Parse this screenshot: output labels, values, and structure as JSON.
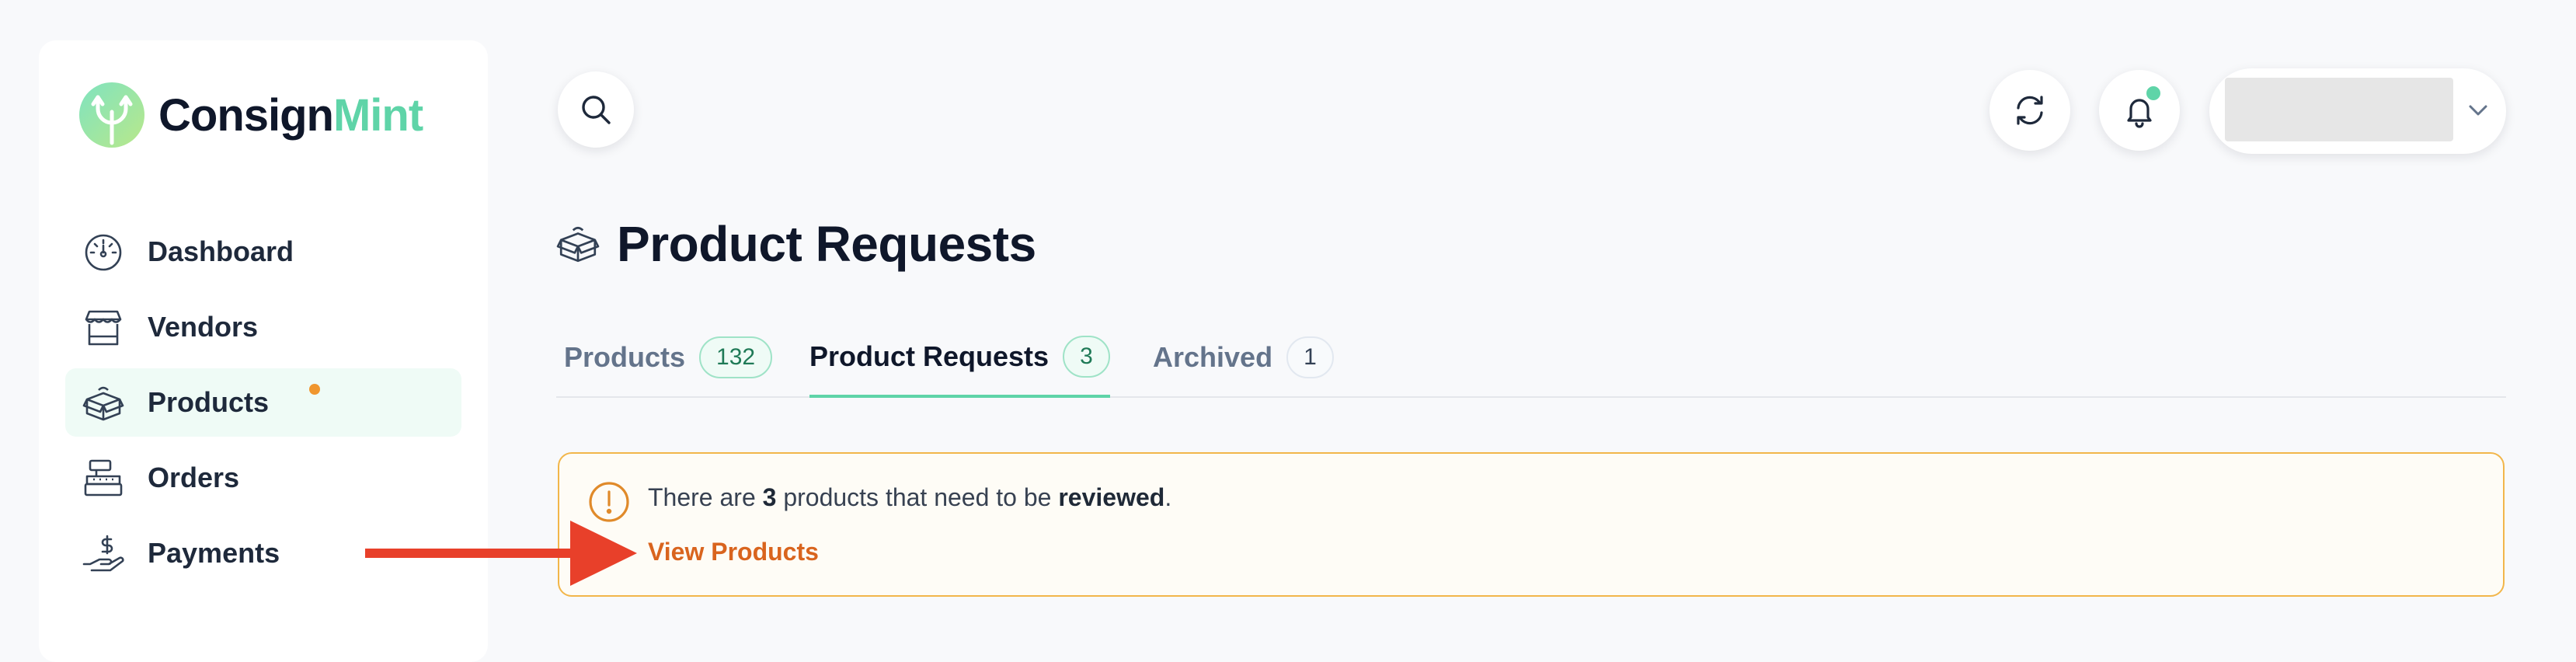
{
  "brand": {
    "name_part1": "Consign",
    "name_part2": "Mint",
    "accent": "#5fd4a8",
    "dark": "#0f172a"
  },
  "sidebar": {
    "items": [
      {
        "label": "Dashboard",
        "icon": "gauge-icon",
        "active": false
      },
      {
        "label": "Vendors",
        "icon": "storefront-icon",
        "active": false
      },
      {
        "label": "Products",
        "icon": "open-box-icon",
        "active": true,
        "notification_dot": true
      },
      {
        "label": "Orders",
        "icon": "cash-register-icon",
        "active": false
      },
      {
        "label": "Payments",
        "icon": "hand-dollar-icon",
        "active": false
      }
    ]
  },
  "header": {
    "search_icon": "search-icon",
    "refresh_icon": "refresh-icon",
    "notifications_icon": "bell-icon",
    "user_menu_icon": "chevron-down-icon"
  },
  "page": {
    "title": "Product Requests",
    "title_icon": "open-box-icon"
  },
  "tabs": [
    {
      "label": "Products",
      "count": "132",
      "active": false
    },
    {
      "label": "Product Requests",
      "count": "3",
      "active": true
    },
    {
      "label": "Archived",
      "count": "1",
      "active": false
    }
  ],
  "alert": {
    "text_before": "There are ",
    "count": "3",
    "text_middle": " products that need to be ",
    "emphasis": "reviewed",
    "text_end": ".",
    "link_label": "View Products",
    "border_color": "#f2b64a",
    "link_color": "#d9641e"
  },
  "annotation": {
    "arrow_color": "#e8402a"
  }
}
